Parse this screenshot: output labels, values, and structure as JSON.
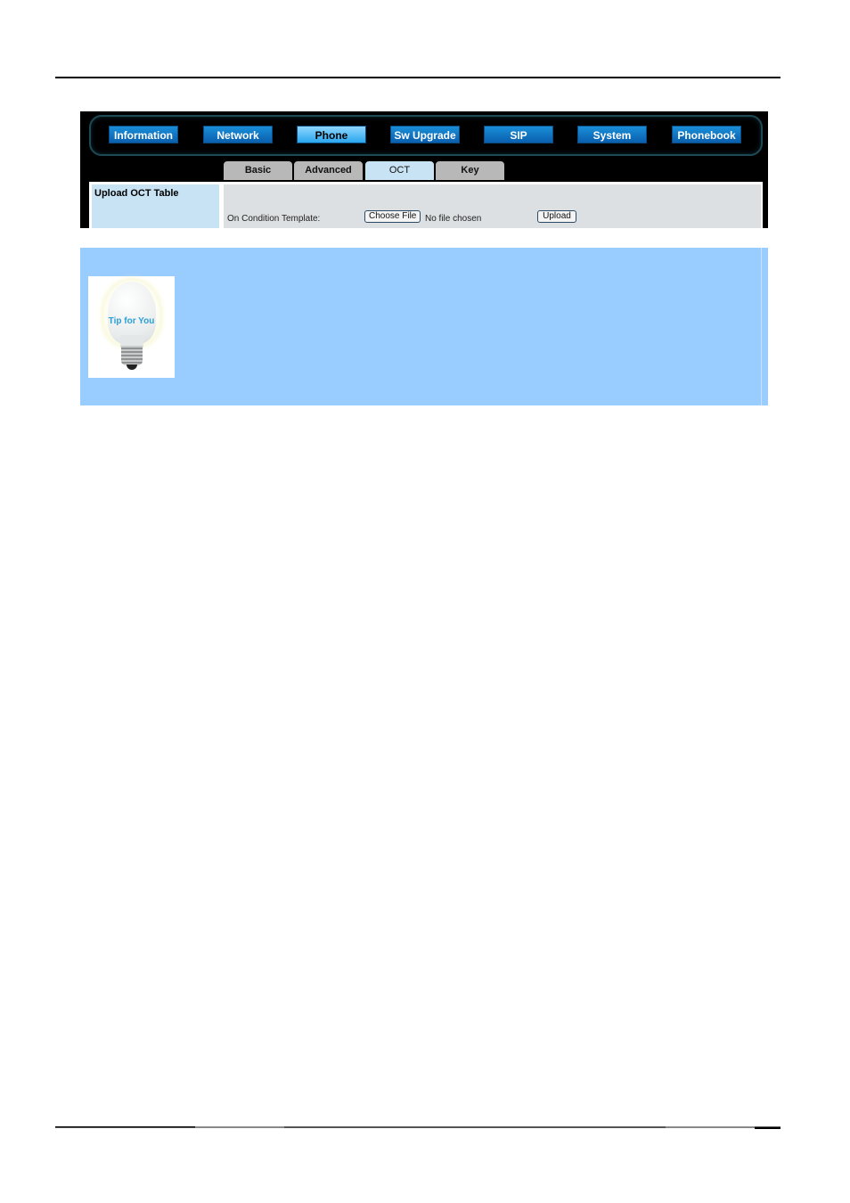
{
  "nav": {
    "items": [
      {
        "label": "Information",
        "active": false
      },
      {
        "label": "Network",
        "active": false
      },
      {
        "label": "Phone",
        "active": true
      },
      {
        "label": "Sw Upgrade",
        "active": false
      },
      {
        "label": "SIP",
        "active": false
      },
      {
        "label": "System",
        "active": false
      },
      {
        "label": "Phonebook",
        "active": false
      }
    ]
  },
  "subtabs": {
    "items": [
      {
        "label": "Basic",
        "active": false
      },
      {
        "label": "Advanced",
        "active": false
      },
      {
        "label": "OCT",
        "active": true
      },
      {
        "label": "Key",
        "active": false
      }
    ]
  },
  "section": {
    "title": "Upload OCT Table",
    "field_label": "On Condition Template:",
    "choose_file_label": "Choose File",
    "file_status": "No file chosen",
    "upload_label": "Upload"
  },
  "tip": {
    "image_text": "Tip for You"
  },
  "colors": {
    "nav_button": "#0a6fc0",
    "nav_active": "#5fc2ff",
    "tab_inactive": "#b8b8b8",
    "tab_active": "#c7e3f4",
    "tip_panel": "#99ccff"
  }
}
